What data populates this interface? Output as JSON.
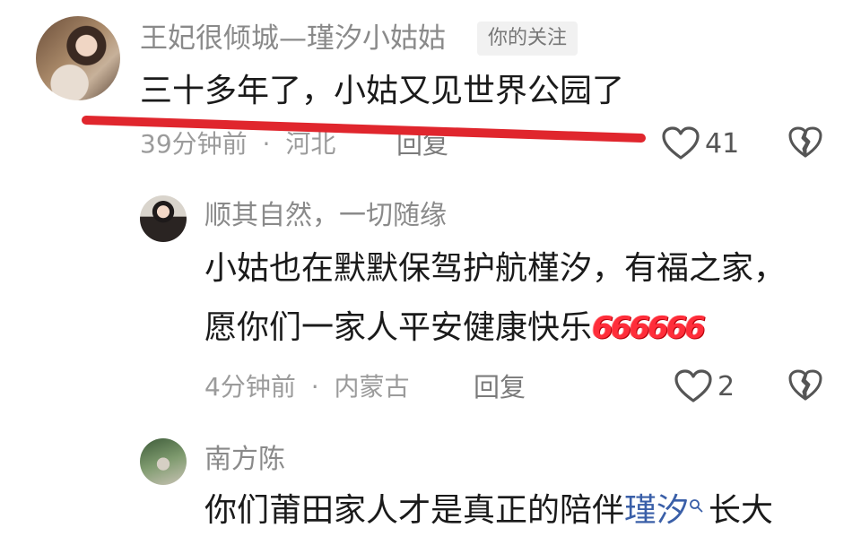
{
  "comments": [
    {
      "username": "王妃很倾城—瑾汐小姑姑",
      "tag": "你的关注",
      "text": "三十多年了，小姑又见世界公园了",
      "time": "39分钟前",
      "location": "河北",
      "reply_label": "回复",
      "likes": "41"
    },
    {
      "username": "顺其自然，一切随缘",
      "text_line1": "小姑也在默默保驾护航槿汐，有福之家，",
      "text_line2": "愿你们一家人平安健康快乐",
      "emoji": "666666",
      "time": "4分钟前",
      "location": "内蒙古",
      "reply_label": "回复",
      "likes": "2"
    },
    {
      "username": "南方陈",
      "text_prefix": "你们莆田家人才是真正的陪伴",
      "text_highlight": "瑾汐",
      "text_suffix": "长大"
    }
  ],
  "separator": "·",
  "colors": {
    "annotation_red": "#e0262d",
    "highlight_blue": "#3a5fa8",
    "emoji_red": "#ff2d3a"
  },
  "icons": [
    "heart-icon",
    "broken-heart-icon",
    "search-icon"
  ]
}
